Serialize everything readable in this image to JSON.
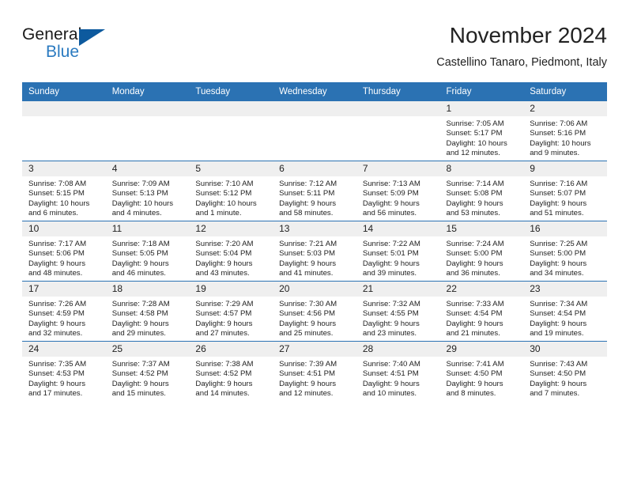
{
  "brand": {
    "name_part1": "General",
    "name_part2": "Blue",
    "flag_color": "#0d5a9e",
    "blue_text_color": "#2a7ac0"
  },
  "header": {
    "title": "November 2024",
    "location": "Castellino Tanaro, Piedmont, Italy"
  },
  "theme": {
    "header_blue": "#2b72b3",
    "daynum_band": "#efefef",
    "text": "#222222"
  },
  "weekday_headers": [
    "Sunday",
    "Monday",
    "Tuesday",
    "Wednesday",
    "Thursday",
    "Friday",
    "Saturday"
  ],
  "weeks": [
    [
      {
        "day": "",
        "empty": true
      },
      {
        "day": "",
        "empty": true
      },
      {
        "day": "",
        "empty": true
      },
      {
        "day": "",
        "empty": true
      },
      {
        "day": "",
        "empty": true
      },
      {
        "day": "1",
        "sunrise": "Sunrise: 7:05 AM",
        "sunset": "Sunset: 5:17 PM",
        "daylight_line1": "Daylight: 10 hours",
        "daylight_line2": "and 12 minutes."
      },
      {
        "day": "2",
        "sunrise": "Sunrise: 7:06 AM",
        "sunset": "Sunset: 5:16 PM",
        "daylight_line1": "Daylight: 10 hours",
        "daylight_line2": "and 9 minutes."
      }
    ],
    [
      {
        "day": "3",
        "sunrise": "Sunrise: 7:08 AM",
        "sunset": "Sunset: 5:15 PM",
        "daylight_line1": "Daylight: 10 hours",
        "daylight_line2": "and 6 minutes."
      },
      {
        "day": "4",
        "sunrise": "Sunrise: 7:09 AM",
        "sunset": "Sunset: 5:13 PM",
        "daylight_line1": "Daylight: 10 hours",
        "daylight_line2": "and 4 minutes."
      },
      {
        "day": "5",
        "sunrise": "Sunrise: 7:10 AM",
        "sunset": "Sunset: 5:12 PM",
        "daylight_line1": "Daylight: 10 hours",
        "daylight_line2": "and 1 minute."
      },
      {
        "day": "6",
        "sunrise": "Sunrise: 7:12 AM",
        "sunset": "Sunset: 5:11 PM",
        "daylight_line1": "Daylight: 9 hours",
        "daylight_line2": "and 58 minutes."
      },
      {
        "day": "7",
        "sunrise": "Sunrise: 7:13 AM",
        "sunset": "Sunset: 5:09 PM",
        "daylight_line1": "Daylight: 9 hours",
        "daylight_line2": "and 56 minutes."
      },
      {
        "day": "8",
        "sunrise": "Sunrise: 7:14 AM",
        "sunset": "Sunset: 5:08 PM",
        "daylight_line1": "Daylight: 9 hours",
        "daylight_line2": "and 53 minutes."
      },
      {
        "day": "9",
        "sunrise": "Sunrise: 7:16 AM",
        "sunset": "Sunset: 5:07 PM",
        "daylight_line1": "Daylight: 9 hours",
        "daylight_line2": "and 51 minutes."
      }
    ],
    [
      {
        "day": "10",
        "sunrise": "Sunrise: 7:17 AM",
        "sunset": "Sunset: 5:06 PM",
        "daylight_line1": "Daylight: 9 hours",
        "daylight_line2": "and 48 minutes."
      },
      {
        "day": "11",
        "sunrise": "Sunrise: 7:18 AM",
        "sunset": "Sunset: 5:05 PM",
        "daylight_line1": "Daylight: 9 hours",
        "daylight_line2": "and 46 minutes."
      },
      {
        "day": "12",
        "sunrise": "Sunrise: 7:20 AM",
        "sunset": "Sunset: 5:04 PM",
        "daylight_line1": "Daylight: 9 hours",
        "daylight_line2": "and 43 minutes."
      },
      {
        "day": "13",
        "sunrise": "Sunrise: 7:21 AM",
        "sunset": "Sunset: 5:03 PM",
        "daylight_line1": "Daylight: 9 hours",
        "daylight_line2": "and 41 minutes."
      },
      {
        "day": "14",
        "sunrise": "Sunrise: 7:22 AM",
        "sunset": "Sunset: 5:01 PM",
        "daylight_line1": "Daylight: 9 hours",
        "daylight_line2": "and 39 minutes."
      },
      {
        "day": "15",
        "sunrise": "Sunrise: 7:24 AM",
        "sunset": "Sunset: 5:00 PM",
        "daylight_line1": "Daylight: 9 hours",
        "daylight_line2": "and 36 minutes."
      },
      {
        "day": "16",
        "sunrise": "Sunrise: 7:25 AM",
        "sunset": "Sunset: 5:00 PM",
        "daylight_line1": "Daylight: 9 hours",
        "daylight_line2": "and 34 minutes."
      }
    ],
    [
      {
        "day": "17",
        "sunrise": "Sunrise: 7:26 AM",
        "sunset": "Sunset: 4:59 PM",
        "daylight_line1": "Daylight: 9 hours",
        "daylight_line2": "and 32 minutes."
      },
      {
        "day": "18",
        "sunrise": "Sunrise: 7:28 AM",
        "sunset": "Sunset: 4:58 PM",
        "daylight_line1": "Daylight: 9 hours",
        "daylight_line2": "and 29 minutes."
      },
      {
        "day": "19",
        "sunrise": "Sunrise: 7:29 AM",
        "sunset": "Sunset: 4:57 PM",
        "daylight_line1": "Daylight: 9 hours",
        "daylight_line2": "and 27 minutes."
      },
      {
        "day": "20",
        "sunrise": "Sunrise: 7:30 AM",
        "sunset": "Sunset: 4:56 PM",
        "daylight_line1": "Daylight: 9 hours",
        "daylight_line2": "and 25 minutes."
      },
      {
        "day": "21",
        "sunrise": "Sunrise: 7:32 AM",
        "sunset": "Sunset: 4:55 PM",
        "daylight_line1": "Daylight: 9 hours",
        "daylight_line2": "and 23 minutes."
      },
      {
        "day": "22",
        "sunrise": "Sunrise: 7:33 AM",
        "sunset": "Sunset: 4:54 PM",
        "daylight_line1": "Daylight: 9 hours",
        "daylight_line2": "and 21 minutes."
      },
      {
        "day": "23",
        "sunrise": "Sunrise: 7:34 AM",
        "sunset": "Sunset: 4:54 PM",
        "daylight_line1": "Daylight: 9 hours",
        "daylight_line2": "and 19 minutes."
      }
    ],
    [
      {
        "day": "24",
        "sunrise": "Sunrise: 7:35 AM",
        "sunset": "Sunset: 4:53 PM",
        "daylight_line1": "Daylight: 9 hours",
        "daylight_line2": "and 17 minutes."
      },
      {
        "day": "25",
        "sunrise": "Sunrise: 7:37 AM",
        "sunset": "Sunset: 4:52 PM",
        "daylight_line1": "Daylight: 9 hours",
        "daylight_line2": "and 15 minutes."
      },
      {
        "day": "26",
        "sunrise": "Sunrise: 7:38 AM",
        "sunset": "Sunset: 4:52 PM",
        "daylight_line1": "Daylight: 9 hours",
        "daylight_line2": "and 14 minutes."
      },
      {
        "day": "27",
        "sunrise": "Sunrise: 7:39 AM",
        "sunset": "Sunset: 4:51 PM",
        "daylight_line1": "Daylight: 9 hours",
        "daylight_line2": "and 12 minutes."
      },
      {
        "day": "28",
        "sunrise": "Sunrise: 7:40 AM",
        "sunset": "Sunset: 4:51 PM",
        "daylight_line1": "Daylight: 9 hours",
        "daylight_line2": "and 10 minutes."
      },
      {
        "day": "29",
        "sunrise": "Sunrise: 7:41 AM",
        "sunset": "Sunset: 4:50 PM",
        "daylight_line1": "Daylight: 9 hours",
        "daylight_line2": "and 8 minutes."
      },
      {
        "day": "30",
        "sunrise": "Sunrise: 7:43 AM",
        "sunset": "Sunset: 4:50 PM",
        "daylight_line1": "Daylight: 9 hours",
        "daylight_line2": "and 7 minutes."
      }
    ]
  ]
}
